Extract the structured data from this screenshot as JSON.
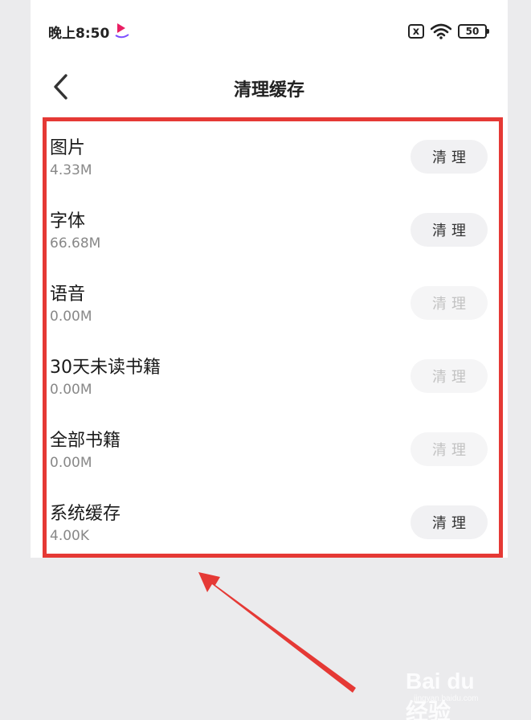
{
  "status_bar": {
    "time": "晚上8:50",
    "sim_label": "x",
    "battery": "50"
  },
  "nav": {
    "title": "清理缓存"
  },
  "items": [
    {
      "title": "图片",
      "size": "4.33M",
      "button": "清理",
      "enabled": true
    },
    {
      "title": "字体",
      "size": "66.68M",
      "button": "清理",
      "enabled": true
    },
    {
      "title": "语音",
      "size": "0.00M",
      "button": "清理",
      "enabled": false
    },
    {
      "title": "30天未读书籍",
      "size": "0.00M",
      "button": "清理",
      "enabled": false
    },
    {
      "title": "全部书籍",
      "size": "0.00M",
      "button": "清理",
      "enabled": false
    },
    {
      "title": "系统缓存",
      "size": "4.00K",
      "button": "清理",
      "enabled": true
    }
  ],
  "annotation": {
    "highlight_color": "#e53935"
  },
  "watermark": {
    "logo": "Bai du 经验",
    "sub": "jingyan.baidu.com"
  }
}
